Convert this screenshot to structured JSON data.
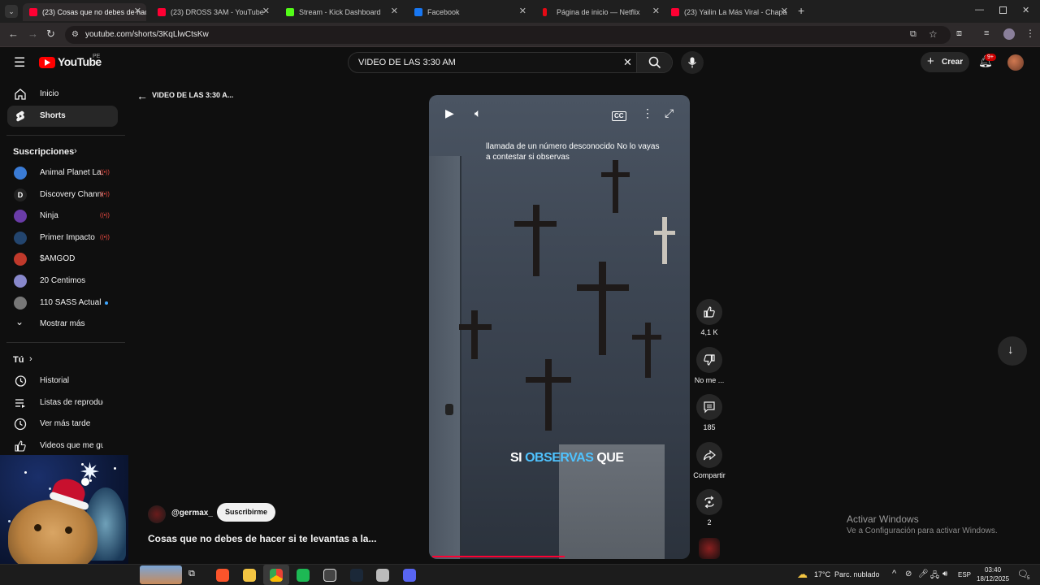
{
  "browser": {
    "tabs": [
      {
        "title": "(23) Cosas que no debes de hacer si te levantas a la...",
        "icon": "youtube-icon",
        "color": "#ff0033",
        "active": true
      },
      {
        "title": "(23) DROSS 3AM - YouTube",
        "icon": "youtube-icon",
        "color": "#ff0033"
      },
      {
        "title": "Stream - Kick Dashboard",
        "icon": "kick-icon",
        "color": "#53fc18"
      },
      {
        "title": "Facebook",
        "icon": "facebook-icon",
        "color": "#1877f2"
      },
      {
        "title": "Página de inicio — Netflix",
        "icon": "netflix-icon",
        "color": "#e50914"
      },
      {
        "title": "(23) Yailin La Más Viral - Chapa",
        "icon": "youtube-icon",
        "color": "#ff0033"
      }
    ],
    "url": "youtube.com/shorts/3KqLlwCtsKw"
  },
  "header": {
    "logo_text": "YouTube",
    "logo_region": "PE",
    "search_value": "VIDEO DE LAS 3:30 AM",
    "create_label": "Crear",
    "notifications_badge": "9+"
  },
  "sidebar": {
    "main": [
      {
        "label": "Inicio",
        "icon": "home-icon"
      },
      {
        "label": "Shorts",
        "icon": "shorts-icon",
        "selected": true
      }
    ],
    "subscriptions_title": "Suscripciones",
    "subscriptions": [
      {
        "label": "Animal Planet La...",
        "live": true,
        "color": "#3a7bd5"
      },
      {
        "label": "Discovery Channel",
        "live": true,
        "color": "#222222"
      },
      {
        "label": "Ninja",
        "live": true,
        "color": "#6a3ca8"
      },
      {
        "label": "Primer Impacto",
        "live": true,
        "color": "#23456e"
      },
      {
        "label": "$AMGOD",
        "live": false,
        "color": "#c0392b"
      },
      {
        "label": "20 Centimos",
        "live": false,
        "color": "#8888cc"
      },
      {
        "label": "110 SASS Actual",
        "live": false,
        "dot": true,
        "color": "#777777"
      }
    ],
    "show_more": "Mostrar más",
    "you_title": "Tú",
    "you": [
      {
        "label": "Historial",
        "icon": "history-icon"
      },
      {
        "label": "Listas de reproducc...",
        "icon": "playlist-icon"
      },
      {
        "label": "Ver más tarde",
        "icon": "clock-icon"
      },
      {
        "label": "Videos que me gus...",
        "icon": "thumb-up-icon"
      }
    ]
  },
  "shorts": {
    "back_title": "VIDEO DE LAS 3:30 A...",
    "caption": "llamada de un número desconocido No lo vayas a contestar si observas",
    "subtitle_pre": "SI ",
    "subtitle_hl": "OBSERVAS",
    "subtitle_post": " QUE",
    "progress": 0.52,
    "likes": "4,1 K",
    "dislike_label": "No me ...",
    "comments": "185",
    "share_label": "Compartir",
    "remix_count": "2",
    "channel": "@germax_",
    "subscribe_label": "Suscribirme",
    "video_title": "Cosas que no debes de hacer si te levantas a la..."
  },
  "watermark": {
    "line1": "Activar Windows",
    "line2": "Ve a Configuración para activar Windows."
  },
  "taskbar": {
    "weather": "17°C",
    "weather_desc": "Parc. nublado",
    "lang": "ESP",
    "time": "03:40",
    "date": "18/12/2025",
    "notif_count": "5"
  }
}
